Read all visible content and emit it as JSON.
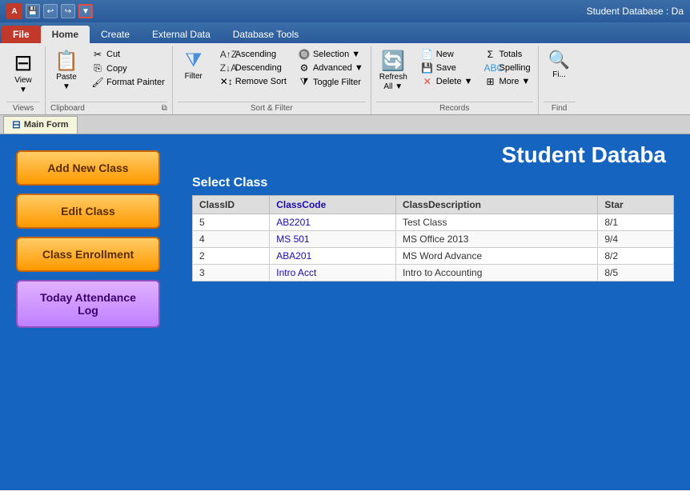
{
  "titleBar": {
    "appIcon": "A",
    "title": "Student Database : Da",
    "quickAccess": [
      "↩",
      "↪",
      "▼"
    ]
  },
  "ribbonTabs": [
    {
      "label": "File",
      "type": "file"
    },
    {
      "label": "Home",
      "type": "active"
    },
    {
      "label": "Create",
      "type": "normal"
    },
    {
      "label": "External Data",
      "type": "normal"
    },
    {
      "label": "Database Tools",
      "type": "normal"
    }
  ],
  "ribbonGroups": {
    "views": {
      "label": "Views",
      "buttons": [
        {
          "label": "View",
          "icon": "⊞"
        }
      ]
    },
    "clipboard": {
      "label": "Clipboard",
      "paste": "Paste",
      "items": [
        {
          "label": "Cut",
          "icon": "✂"
        },
        {
          "label": "Copy",
          "icon": "⎘"
        },
        {
          "label": "Format Painter",
          "icon": "🖌"
        }
      ]
    },
    "sortFilter": {
      "label": "Sort & Filter",
      "filter": "Filter",
      "items": [
        {
          "label": "Ascending",
          "icon": "↑"
        },
        {
          "label": "Descending",
          "icon": "↓"
        },
        {
          "label": "Remove Sort",
          "icon": "✕"
        },
        {
          "label": "Advanced",
          "icon": "▼"
        },
        {
          "label": "Toggle Filter",
          "icon": "▽"
        }
      ]
    },
    "records": {
      "label": "Records",
      "refreshLabel": "Refresh All",
      "items": [
        {
          "label": "New",
          "icon": "📄"
        },
        {
          "label": "Save",
          "icon": "💾"
        },
        {
          "label": "Delete",
          "icon": "✕"
        },
        {
          "label": "Totals",
          "icon": "Σ"
        },
        {
          "label": "Spelling",
          "icon": "ABC"
        },
        {
          "label": "More",
          "icon": "▼"
        }
      ]
    }
  },
  "formTab": {
    "icon": "⊞",
    "label": "Main Form"
  },
  "mainContent": {
    "title": "Student Databa",
    "selectClassLabel": "Select Class",
    "buttons": [
      {
        "label": "Add New Class",
        "type": "orange"
      },
      {
        "label": "Edit Class",
        "type": "orange"
      },
      {
        "label": "Class Enrollment",
        "type": "orange"
      },
      {
        "label": "Today Attendance\nLog",
        "type": "purple"
      }
    ],
    "tableHeaders": [
      "ClassID",
      "ClassCode",
      "ClassDescription",
      "Star"
    ],
    "tableRows": [
      {
        "classId": "5",
        "classCode": "AB2201",
        "classDescription": "Test Class",
        "start": "8/1"
      },
      {
        "classId": "4",
        "classCode": "MS 501",
        "classDescription": "MS Office 2013",
        "start": "9/4"
      },
      {
        "classId": "2",
        "classCode": "ABA201",
        "classDescription": "MS Word Advance",
        "start": "8/2"
      },
      {
        "classId": "3",
        "classCode": "Intro Acct",
        "classDescription": "Intro to Accounting",
        "start": "8/5"
      }
    ]
  }
}
